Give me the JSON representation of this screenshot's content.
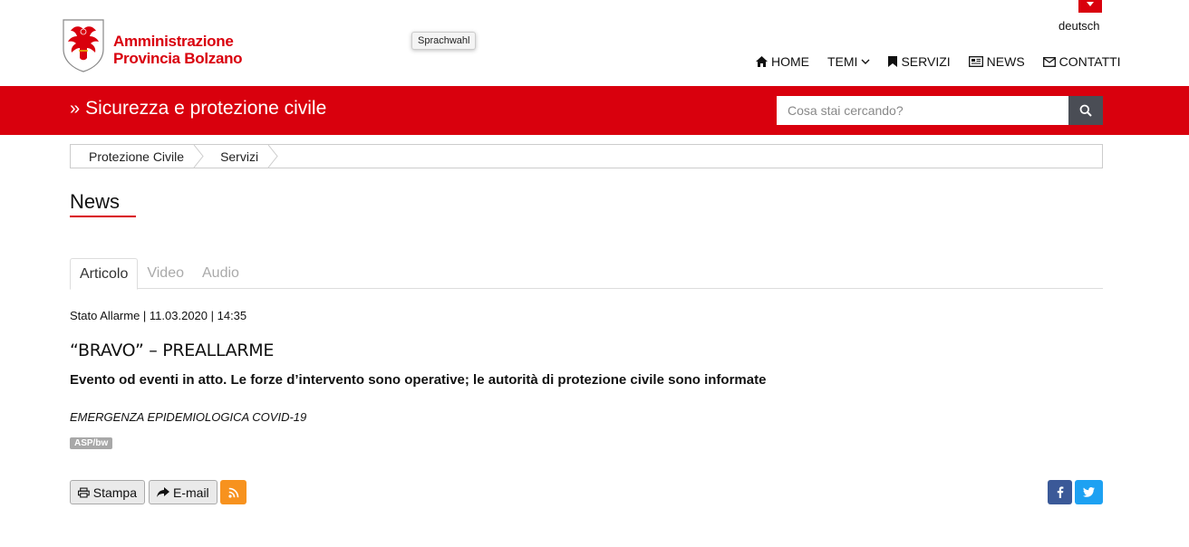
{
  "header": {
    "logo_line1": "Amministrazione",
    "logo_line2": "Provincia Bolzano",
    "language": "deutsch",
    "tooltip": "Sprachwahl"
  },
  "nav": {
    "home": "HOME",
    "temi": "TEMI",
    "servizi": "SERVIZI",
    "news": "NEWS",
    "contatti": "CONTATTI"
  },
  "section": {
    "title": "Sicurezza e protezione civile",
    "search_placeholder": "Cosa stai cercando?"
  },
  "breadcrumb": [
    "Protezione Civile",
    "Servizi"
  ],
  "page_title": "News",
  "tabs": [
    "Articolo",
    "Video",
    "Audio"
  ],
  "article": {
    "meta": "Stato Allarme | 11.03.2020 | 14:35",
    "title": "“BRAVO” – PREALLARME",
    "subtitle": "Evento od eventi in atto. Le forze d’intervento sono operative; le autorità di protezione civile sono informate",
    "category": "EMERGENZA EPIDEMIOLOGICA COVID-19",
    "tag": "ASP/bw"
  },
  "actions": {
    "print": "Stampa",
    "email": "E-mail"
  },
  "colors": {
    "brand_red": "#d9000d",
    "search_button": "#4a4d55",
    "rss": "#f7921e",
    "facebook": "#3b5998",
    "twitter": "#1da1f2"
  }
}
